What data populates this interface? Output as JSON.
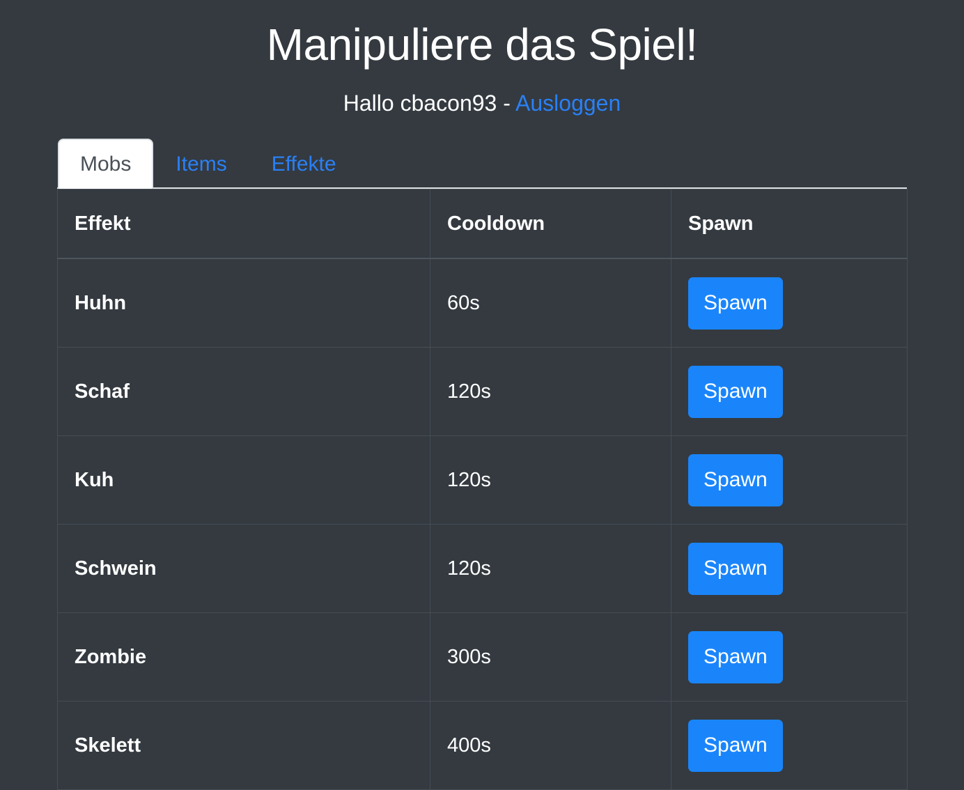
{
  "header": {
    "title": "Manipuliere das Spiel!",
    "greeting_prefix": "Hallo cbacon93 - ",
    "logout_label": "Ausloggen"
  },
  "tabs": [
    {
      "label": "Mobs",
      "active": true
    },
    {
      "label": "Items",
      "active": false
    },
    {
      "label": "Effekte",
      "active": false
    }
  ],
  "table": {
    "columns": [
      "Effekt",
      "Cooldown",
      "Spawn"
    ],
    "rows": [
      {
        "name": "Huhn",
        "cooldown": "60s",
        "action": "Spawn"
      },
      {
        "name": "Schaf",
        "cooldown": "120s",
        "action": "Spawn"
      },
      {
        "name": "Kuh",
        "cooldown": "120s",
        "action": "Spawn"
      },
      {
        "name": "Schwein",
        "cooldown": "120s",
        "action": "Spawn"
      },
      {
        "name": "Zombie",
        "cooldown": "300s",
        "action": "Spawn"
      },
      {
        "name": "Skelett",
        "cooldown": "400s",
        "action": "Spawn"
      }
    ]
  },
  "colors": {
    "background": "#343a40",
    "link": "#2a80f5",
    "button": "#1a85fb",
    "border": "#454d55",
    "tab_border": "#dee2e6"
  }
}
